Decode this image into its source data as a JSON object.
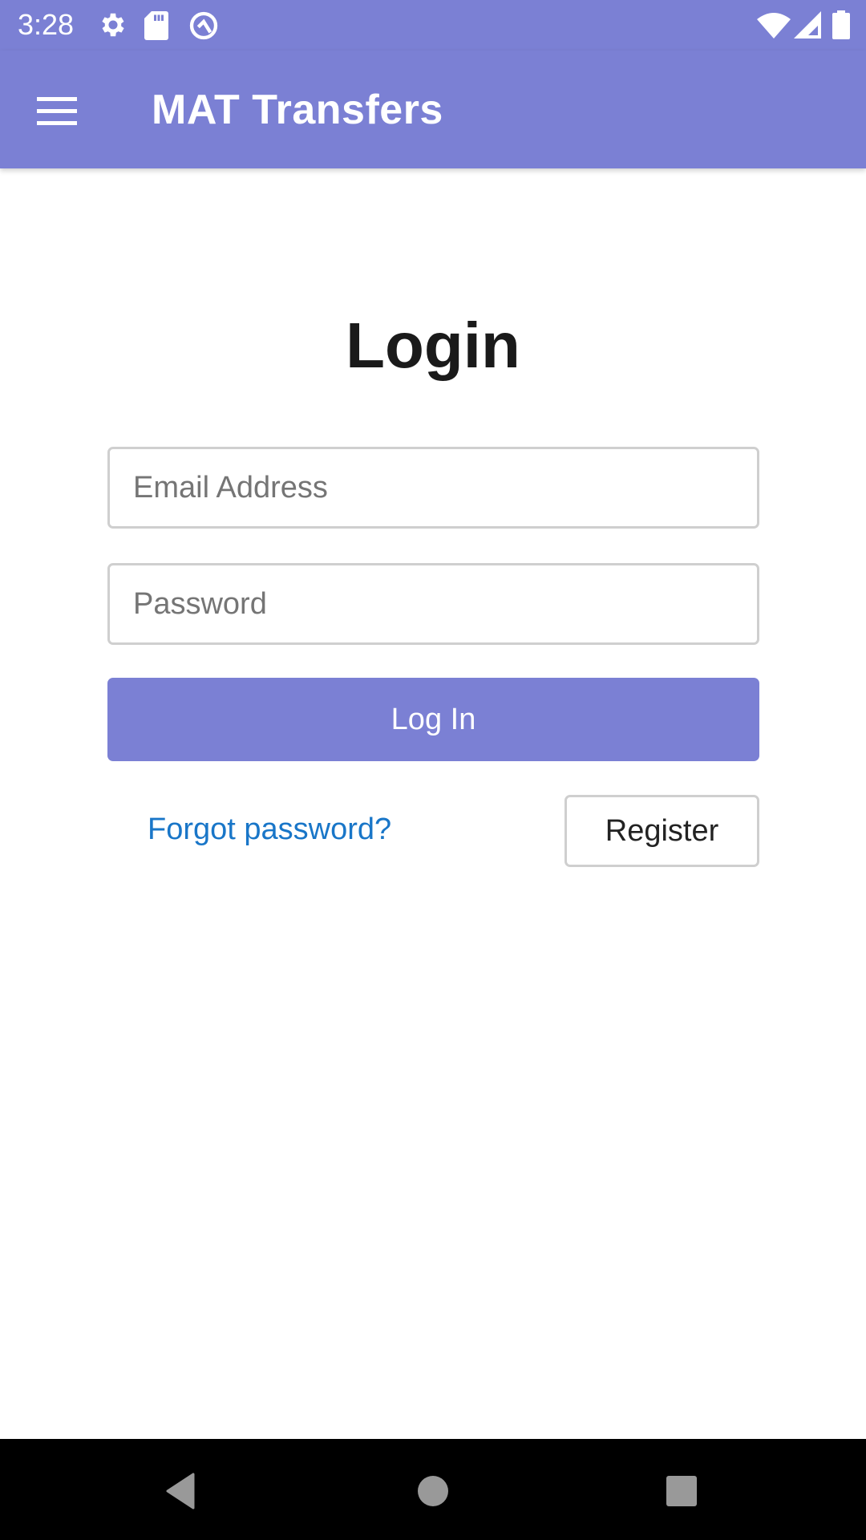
{
  "status_bar": {
    "time": "3:28",
    "left_icons": [
      "gear-icon",
      "sd-card-icon",
      "vpn-q-icon"
    ],
    "right_icons": [
      "wifi-icon",
      "cell-signal-icon",
      "battery-icon"
    ]
  },
  "app_bar": {
    "menu_icon": "hamburger-menu-icon",
    "title": "MAT Transfers",
    "color": "#7b80d4"
  },
  "login_form": {
    "title": "Login",
    "email": {
      "value": "",
      "placeholder": "Email Address"
    },
    "password": {
      "value": "",
      "placeholder": "Password"
    },
    "login_button": "Log In",
    "forgot_link": "Forgot password?",
    "register_button": "Register",
    "link_color": "#1976c8"
  },
  "nav_bar": {
    "buttons": [
      "back-icon",
      "home-icon",
      "recents-icon"
    ]
  }
}
